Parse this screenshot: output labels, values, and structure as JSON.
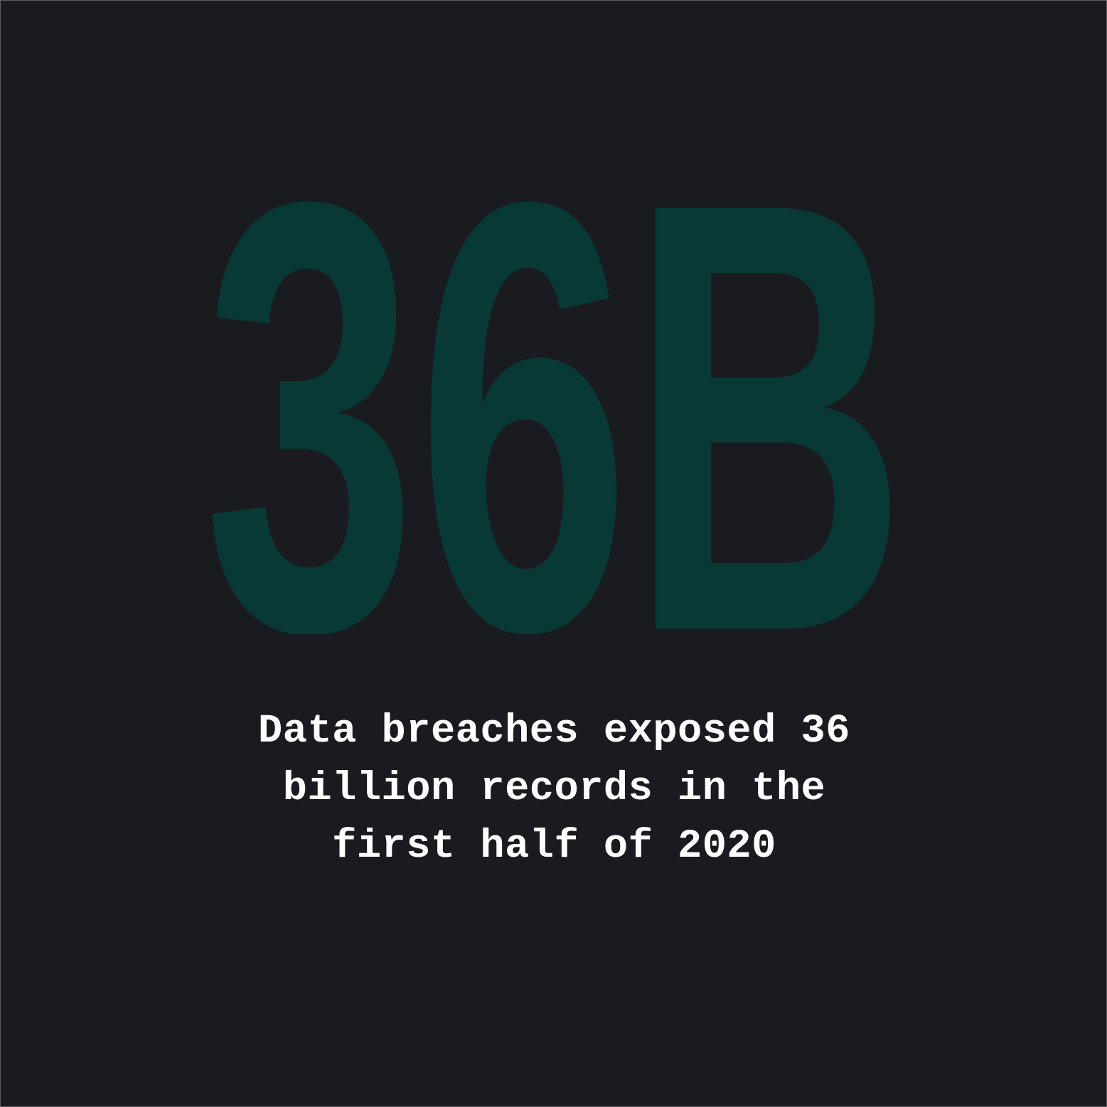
{
  "stat": {
    "value": "36B",
    "color": "#083935"
  },
  "caption": {
    "lines": [
      "Data breaches exposed 36",
      "billion records in the",
      "first half of 2020"
    ],
    "color": "#ffffff"
  },
  "background_color": "#1a1b20"
}
